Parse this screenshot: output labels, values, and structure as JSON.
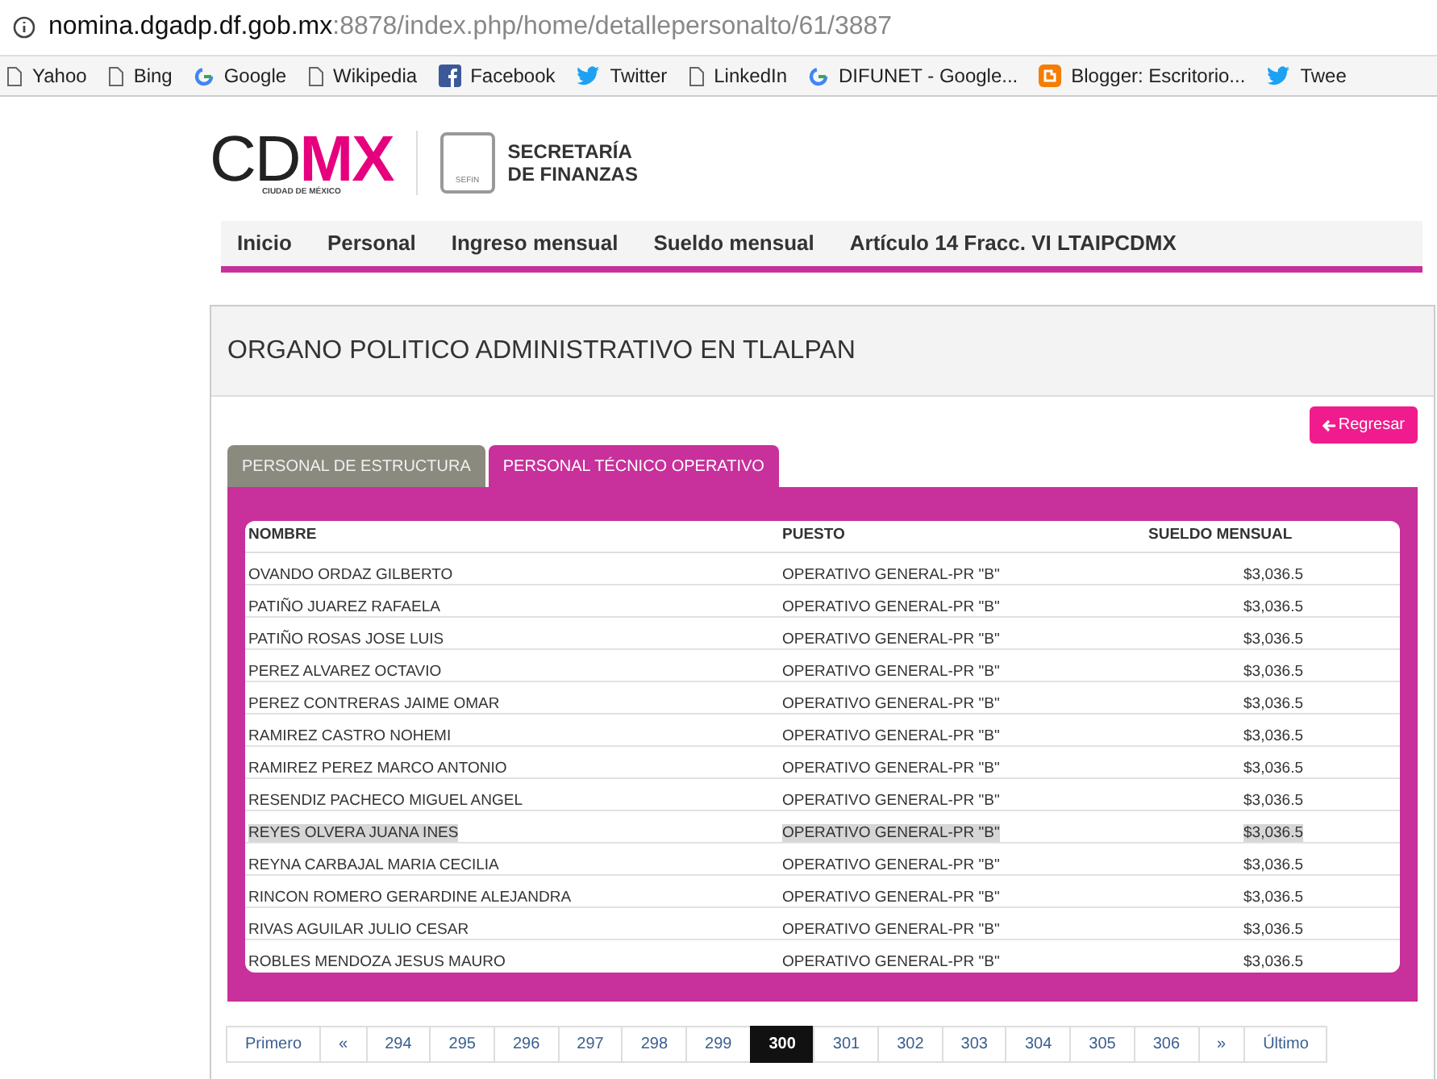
{
  "browser": {
    "url_host": "nomina.dgadp.df.gob.mx",
    "url_rest": ":8878/index.php/home/detallepersonalto/61/3887",
    "bookmarks": [
      {
        "label": "Yahoo",
        "kind": "page"
      },
      {
        "label": "Bing",
        "kind": "page"
      },
      {
        "label": "Google",
        "kind": "google"
      },
      {
        "label": "Wikipedia",
        "kind": "page"
      },
      {
        "label": "Facebook",
        "kind": "facebook"
      },
      {
        "label": "Twitter",
        "kind": "twitter"
      },
      {
        "label": "LinkedIn",
        "kind": "page"
      },
      {
        "label": "DIFUNET - Google...",
        "kind": "google"
      },
      {
        "label": "Blogger: Escritorio...",
        "kind": "blogger"
      },
      {
        "label": "Twee",
        "kind": "twitter"
      }
    ]
  },
  "header": {
    "logo_cd": "CD",
    "logo_mx": "MX",
    "logo_sub": "CIUDAD DE MÉXICO",
    "emblem_text": "SEFIN",
    "secretaria": [
      "SECRETARÍA",
      "DE FINANZAS"
    ]
  },
  "nav": [
    "Inicio",
    "Personal",
    "Ingreso mensual",
    "Sueldo mensual",
    "Artículo 14 Fracc. VI LTAIPCDMX"
  ],
  "panel_title": "ORGANO POLITICO ADMINISTRATIVO EN TLALPAN",
  "back_button": "Regresar",
  "tabs": [
    {
      "label": "PERSONAL DE ESTRUCTURA",
      "selected": false
    },
    {
      "label": "PERSONAL TÉCNICO OPERATIVO",
      "selected": true
    }
  ],
  "table": {
    "columns": [
      "NOMBRE",
      "PUESTO",
      "SUELDO MENSUAL"
    ],
    "rows": [
      {
        "cells": [
          "OVANDO ORDAZ GILBERTO",
          "OPERATIVO GENERAL-PR \"B\"",
          "$3,036.5"
        ],
        "highlighted": false
      },
      {
        "cells": [
          "PATIÑO JUAREZ RAFAELA",
          "OPERATIVO GENERAL-PR \"B\"",
          "$3,036.5"
        ],
        "highlighted": false
      },
      {
        "cells": [
          "PATIÑO ROSAS JOSE LUIS",
          "OPERATIVO GENERAL-PR \"B\"",
          "$3,036.5"
        ],
        "highlighted": false
      },
      {
        "cells": [
          "PEREZ ALVAREZ OCTAVIO",
          "OPERATIVO GENERAL-PR \"B\"",
          "$3,036.5"
        ],
        "highlighted": false
      },
      {
        "cells": [
          "PEREZ CONTRERAS JAIME OMAR",
          "OPERATIVO GENERAL-PR \"B\"",
          "$3,036.5"
        ],
        "highlighted": false
      },
      {
        "cells": [
          "RAMIREZ CASTRO NOHEMI",
          "OPERATIVO GENERAL-PR \"B\"",
          "$3,036.5"
        ],
        "highlighted": false
      },
      {
        "cells": [
          "RAMIREZ PEREZ MARCO ANTONIO",
          "OPERATIVO GENERAL-PR \"B\"",
          "$3,036.5"
        ],
        "highlighted": false
      },
      {
        "cells": [
          "RESENDIZ PACHECO MIGUEL ANGEL",
          "OPERATIVO GENERAL-PR \"B\"",
          "$3,036.5"
        ],
        "highlighted": false
      },
      {
        "cells": [
          "REYES OLVERA JUANA INES",
          "OPERATIVO GENERAL-PR \"B\"",
          "$3,036.5"
        ],
        "highlighted": true
      },
      {
        "cells": [
          "REYNA CARBAJAL MARIA CECILIA",
          "OPERATIVO GENERAL-PR \"B\"",
          "$3,036.5"
        ],
        "highlighted": false
      },
      {
        "cells": [
          "RINCON ROMERO GERARDINE ALEJANDRA",
          "OPERATIVO GENERAL-PR \"B\"",
          "$3,036.5"
        ],
        "highlighted": false
      },
      {
        "cells": [
          "RIVAS AGUILAR JULIO CESAR",
          "OPERATIVO GENERAL-PR \"B\"",
          "$3,036.5"
        ],
        "highlighted": false
      },
      {
        "cells": [
          "ROBLES MENDOZA JESUS MAURO",
          "OPERATIVO GENERAL-PR \"B\"",
          "$3,036.5"
        ],
        "highlighted": false
      }
    ]
  },
  "pagination": [
    {
      "label": "Primero",
      "selected": false
    },
    {
      "label": "«",
      "selected": false
    },
    {
      "label": "294",
      "selected": false
    },
    {
      "label": "295",
      "selected": false
    },
    {
      "label": "296",
      "selected": false
    },
    {
      "label": "297",
      "selected": false
    },
    {
      "label": "298",
      "selected": false
    },
    {
      "label": "299",
      "selected": false
    },
    {
      "label": "300",
      "selected": true
    },
    {
      "label": "301",
      "selected": false
    },
    {
      "label": "302",
      "selected": false
    },
    {
      "label": "303",
      "selected": false
    },
    {
      "label": "304",
      "selected": false
    },
    {
      "label": "305",
      "selected": false
    },
    {
      "label": "306",
      "selected": false
    },
    {
      "label": "»",
      "selected": false
    },
    {
      "label": "Último",
      "selected": false
    }
  ]
}
